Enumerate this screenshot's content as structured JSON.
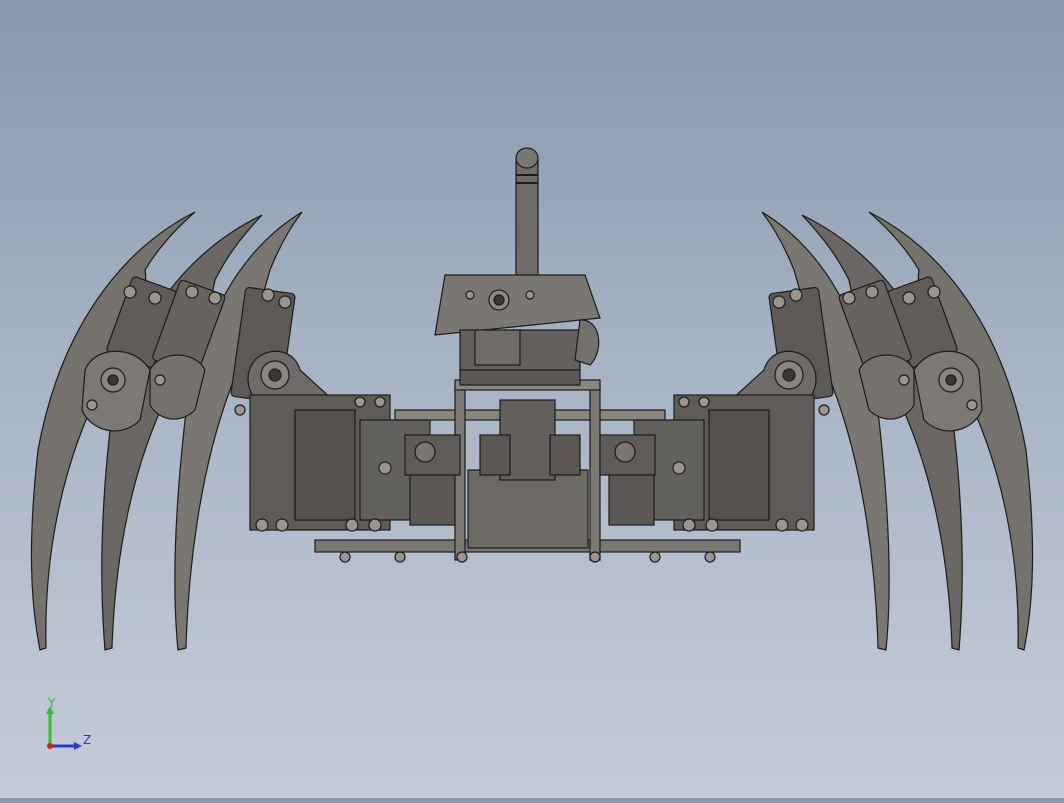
{
  "viewport": {
    "background_top": "#8797ad",
    "background_bottom": "#c5ccd8",
    "model_fill": "#6e6b68",
    "model_edge": "#1c1c1c"
  },
  "triad": {
    "y_label": "Y",
    "z_label": "Z",
    "y_color": "#2fbf2f",
    "z_color": "#2a3cc8",
    "origin_color": "#d02020"
  }
}
